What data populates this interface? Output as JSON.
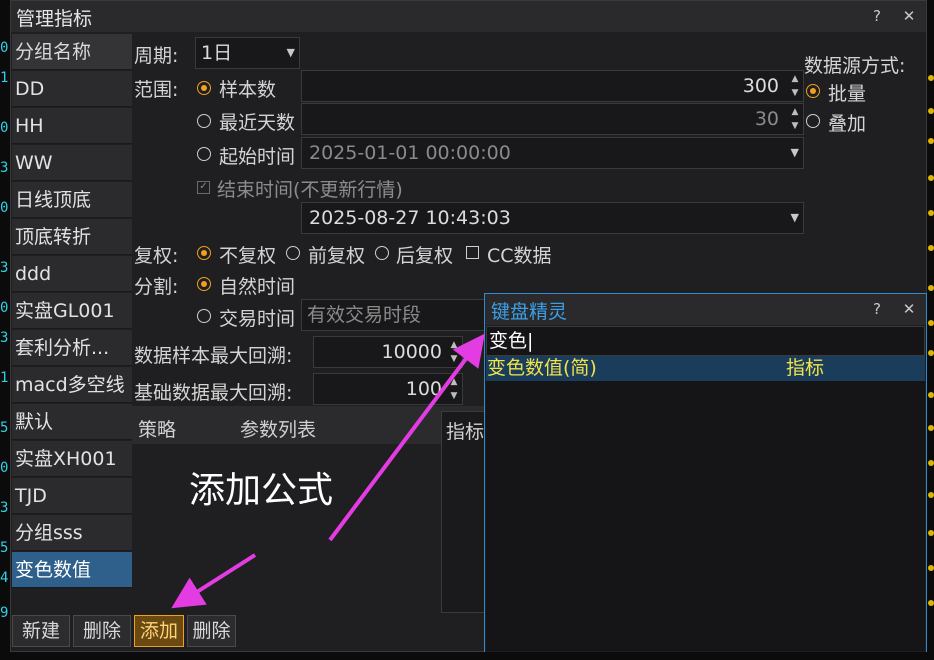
{
  "window": {
    "title": "管理指标"
  },
  "groups": {
    "header": "分组名称",
    "items": [
      "DD",
      "HH",
      "WW",
      "日线顶底",
      "顶底转折",
      "ddd",
      "实盘GL001",
      "套利分析...",
      "macd多空线",
      "默认",
      "实盘XH001",
      "TJD",
      "分组sss",
      "变色数值"
    ],
    "selected": "变色数值"
  },
  "period": {
    "label": "周期:",
    "value": "1日"
  },
  "range": {
    "label": "范围:",
    "sample_count": {
      "label": "样本数",
      "value": "300",
      "checked": true
    },
    "recent_days": {
      "label": "最近天数",
      "value": "30",
      "checked": false
    },
    "start_time": {
      "label": "起始时间",
      "value": "2025-01-01 00:00:00",
      "checked": false
    },
    "end_time": {
      "label": "结束时间(不更新行情)",
      "value": "2025-08-27 10:43:03",
      "checked": true
    }
  },
  "datasource": {
    "label": "数据源方式:",
    "options": [
      "批量",
      "叠加"
    ],
    "selected": "批量"
  },
  "rights": {
    "label": "复权:",
    "options": [
      "不复权",
      "前复权",
      "后复权"
    ],
    "selected": "不复权",
    "cc_label": "CC数据"
  },
  "split": {
    "label": "分割:",
    "natural": "自然时间",
    "trade": "交易时间",
    "trade_placeholder": "有效交易时段",
    "selected": "自然时间"
  },
  "max_lookback": {
    "label": "数据样本最大回溯:",
    "value": "10000"
  },
  "base_lookback": {
    "label": "基础数据最大回溯:",
    "value": "100"
  },
  "table": {
    "col_strategy": "策略",
    "col_params": "参数列表",
    "col_indicator": "指标"
  },
  "annotation": "添加公式",
  "buttons": {
    "new": "新建",
    "delete": "删除",
    "add": "添加",
    "delete2": "删除"
  },
  "wizard": {
    "title": "键盘精灵",
    "query": "变色",
    "results": [
      {
        "name": "变色数值(简)",
        "type": "指标"
      }
    ]
  },
  "colors": {
    "accent": "#f0a020",
    "selected": "#2f5f8b",
    "arrow": "#e33ce3",
    "wizard_border": "#2e8bd0"
  }
}
